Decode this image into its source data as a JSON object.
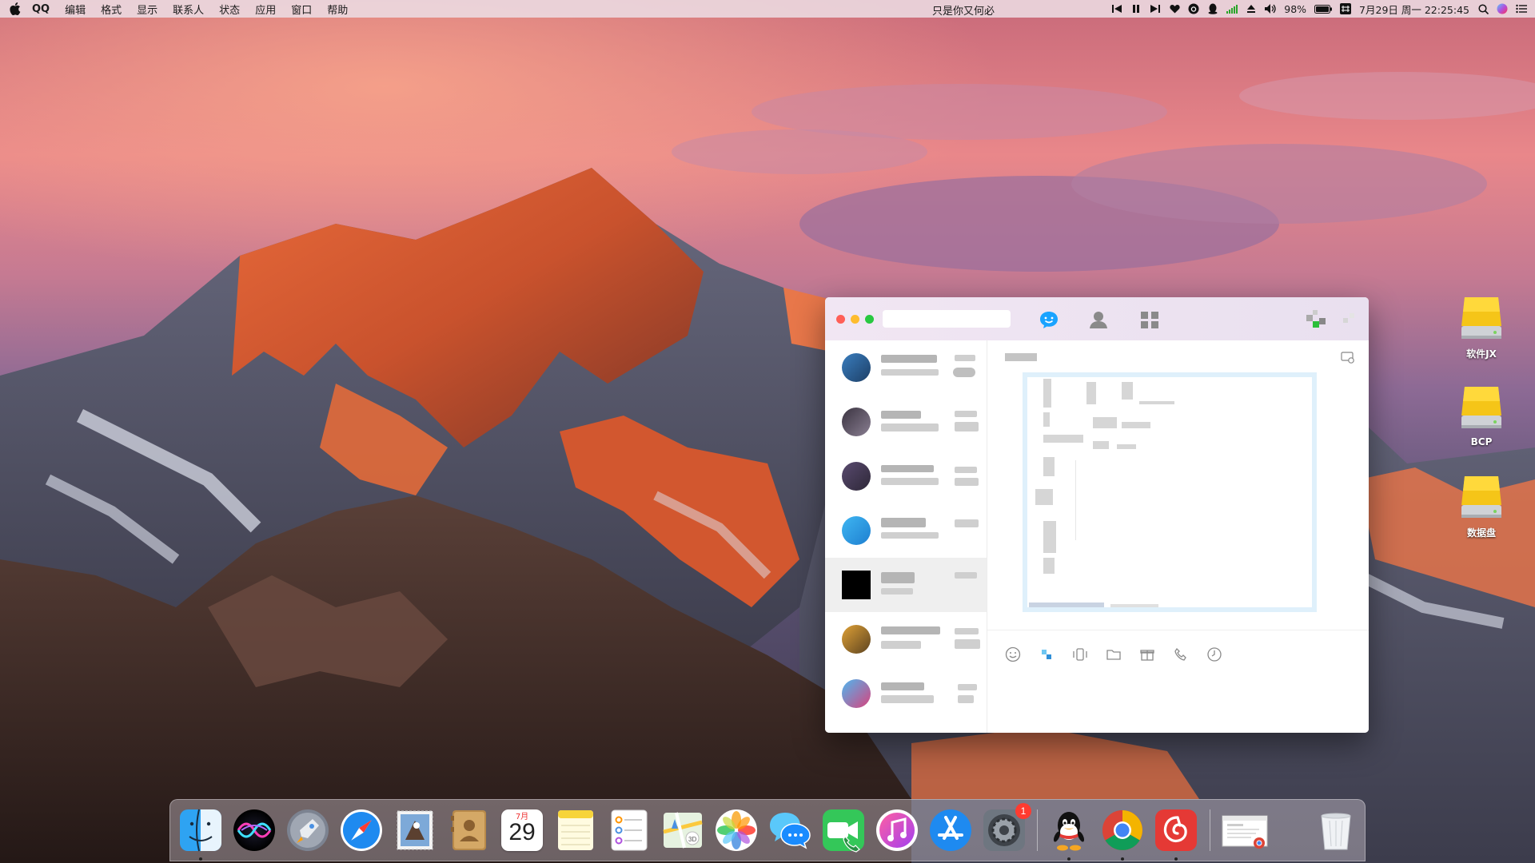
{
  "menubar": {
    "app_name": "QQ",
    "items": [
      "编辑",
      "格式",
      "显示",
      "联系人",
      "状态",
      "应用",
      "窗口",
      "帮助"
    ],
    "song_text": "只是你又何必",
    "battery": "98%",
    "datetime": "7月29日 周一  22:25:45"
  },
  "desktop": {
    "drives": [
      {
        "label": "软件JX"
      },
      {
        "label": "BCP"
      },
      {
        "label": "数据盘"
      }
    ]
  },
  "qq_window": {
    "tabs": [
      "messages-tab",
      "contacts-tab",
      "apps-tab"
    ],
    "contacts_count": 7,
    "selected_contact_index": 4,
    "colors": {
      "accent": "#1aa3ff",
      "titlebar": "#efe5f2"
    },
    "toolbar_icons": [
      "emoji-icon",
      "screenshot-icon",
      "shake-icon",
      "folder-icon",
      "gift-icon",
      "phone-icon",
      "history-icon"
    ]
  },
  "dock": {
    "apps": [
      {
        "name": "finder-icon",
        "running": true
      },
      {
        "name": "siri-icon",
        "running": false
      },
      {
        "name": "launchpad-icon",
        "running": false
      },
      {
        "name": "safari-icon",
        "running": false
      },
      {
        "name": "mail-icon",
        "running": false
      },
      {
        "name": "contacts-icon",
        "running": false
      },
      {
        "name": "calendar-icon",
        "running": false
      },
      {
        "name": "notes-icon",
        "running": false
      },
      {
        "name": "reminders-icon",
        "running": false
      },
      {
        "name": "maps-icon",
        "running": false
      },
      {
        "name": "photos-icon",
        "running": false
      },
      {
        "name": "messages-icon",
        "running": false
      },
      {
        "name": "facetime-icon",
        "running": false
      },
      {
        "name": "itunes-icon",
        "running": false
      },
      {
        "name": "app-store-icon",
        "running": false
      },
      {
        "name": "system-preferences-icon",
        "running": false
      },
      {
        "name": "qq-icon",
        "running": true
      },
      {
        "name": "chrome-icon",
        "running": true
      },
      {
        "name": "netease-music-icon",
        "running": true
      }
    ],
    "calendar": {
      "month": "7月",
      "day": "29"
    },
    "system_preferences_badge": "1"
  }
}
